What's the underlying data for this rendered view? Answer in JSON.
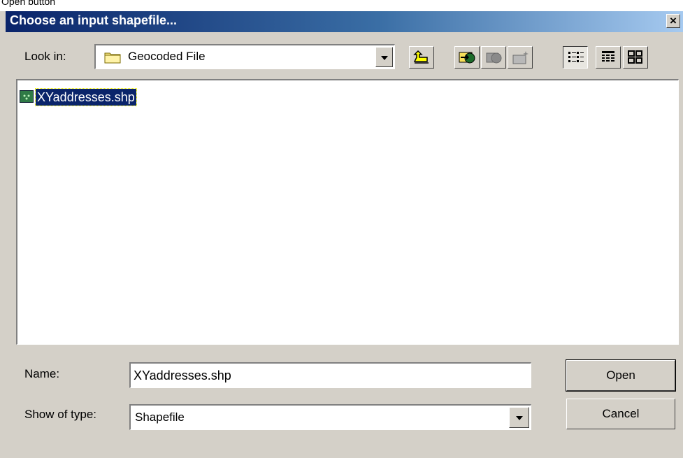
{
  "top_strip_text": "Open button",
  "dialog": {
    "title": "Choose an input shapefile...",
    "close_label": "×"
  },
  "lookin": {
    "label": "Look in:",
    "value": "Geocoded File"
  },
  "toolbar": {
    "buttons": [
      "up-one-level",
      "connect-to-folder",
      "disconnect-from-folder",
      "new-folder",
      "list-view",
      "details-view",
      "thumbnails-view"
    ]
  },
  "files": [
    {
      "name": "XYaddresses.shp",
      "selected": true
    }
  ],
  "name_field": {
    "label": "Name:",
    "value": "XYaddresses.shp"
  },
  "type_field": {
    "label": "Show of type:",
    "value": "Shapefile"
  },
  "buttons": {
    "open": "Open",
    "cancel": "Cancel"
  },
  "colors": {
    "title_start": "#0a246a",
    "title_end": "#a6caf0",
    "dialog_bg": "#d4d0c8",
    "selection": "#0a246a"
  }
}
